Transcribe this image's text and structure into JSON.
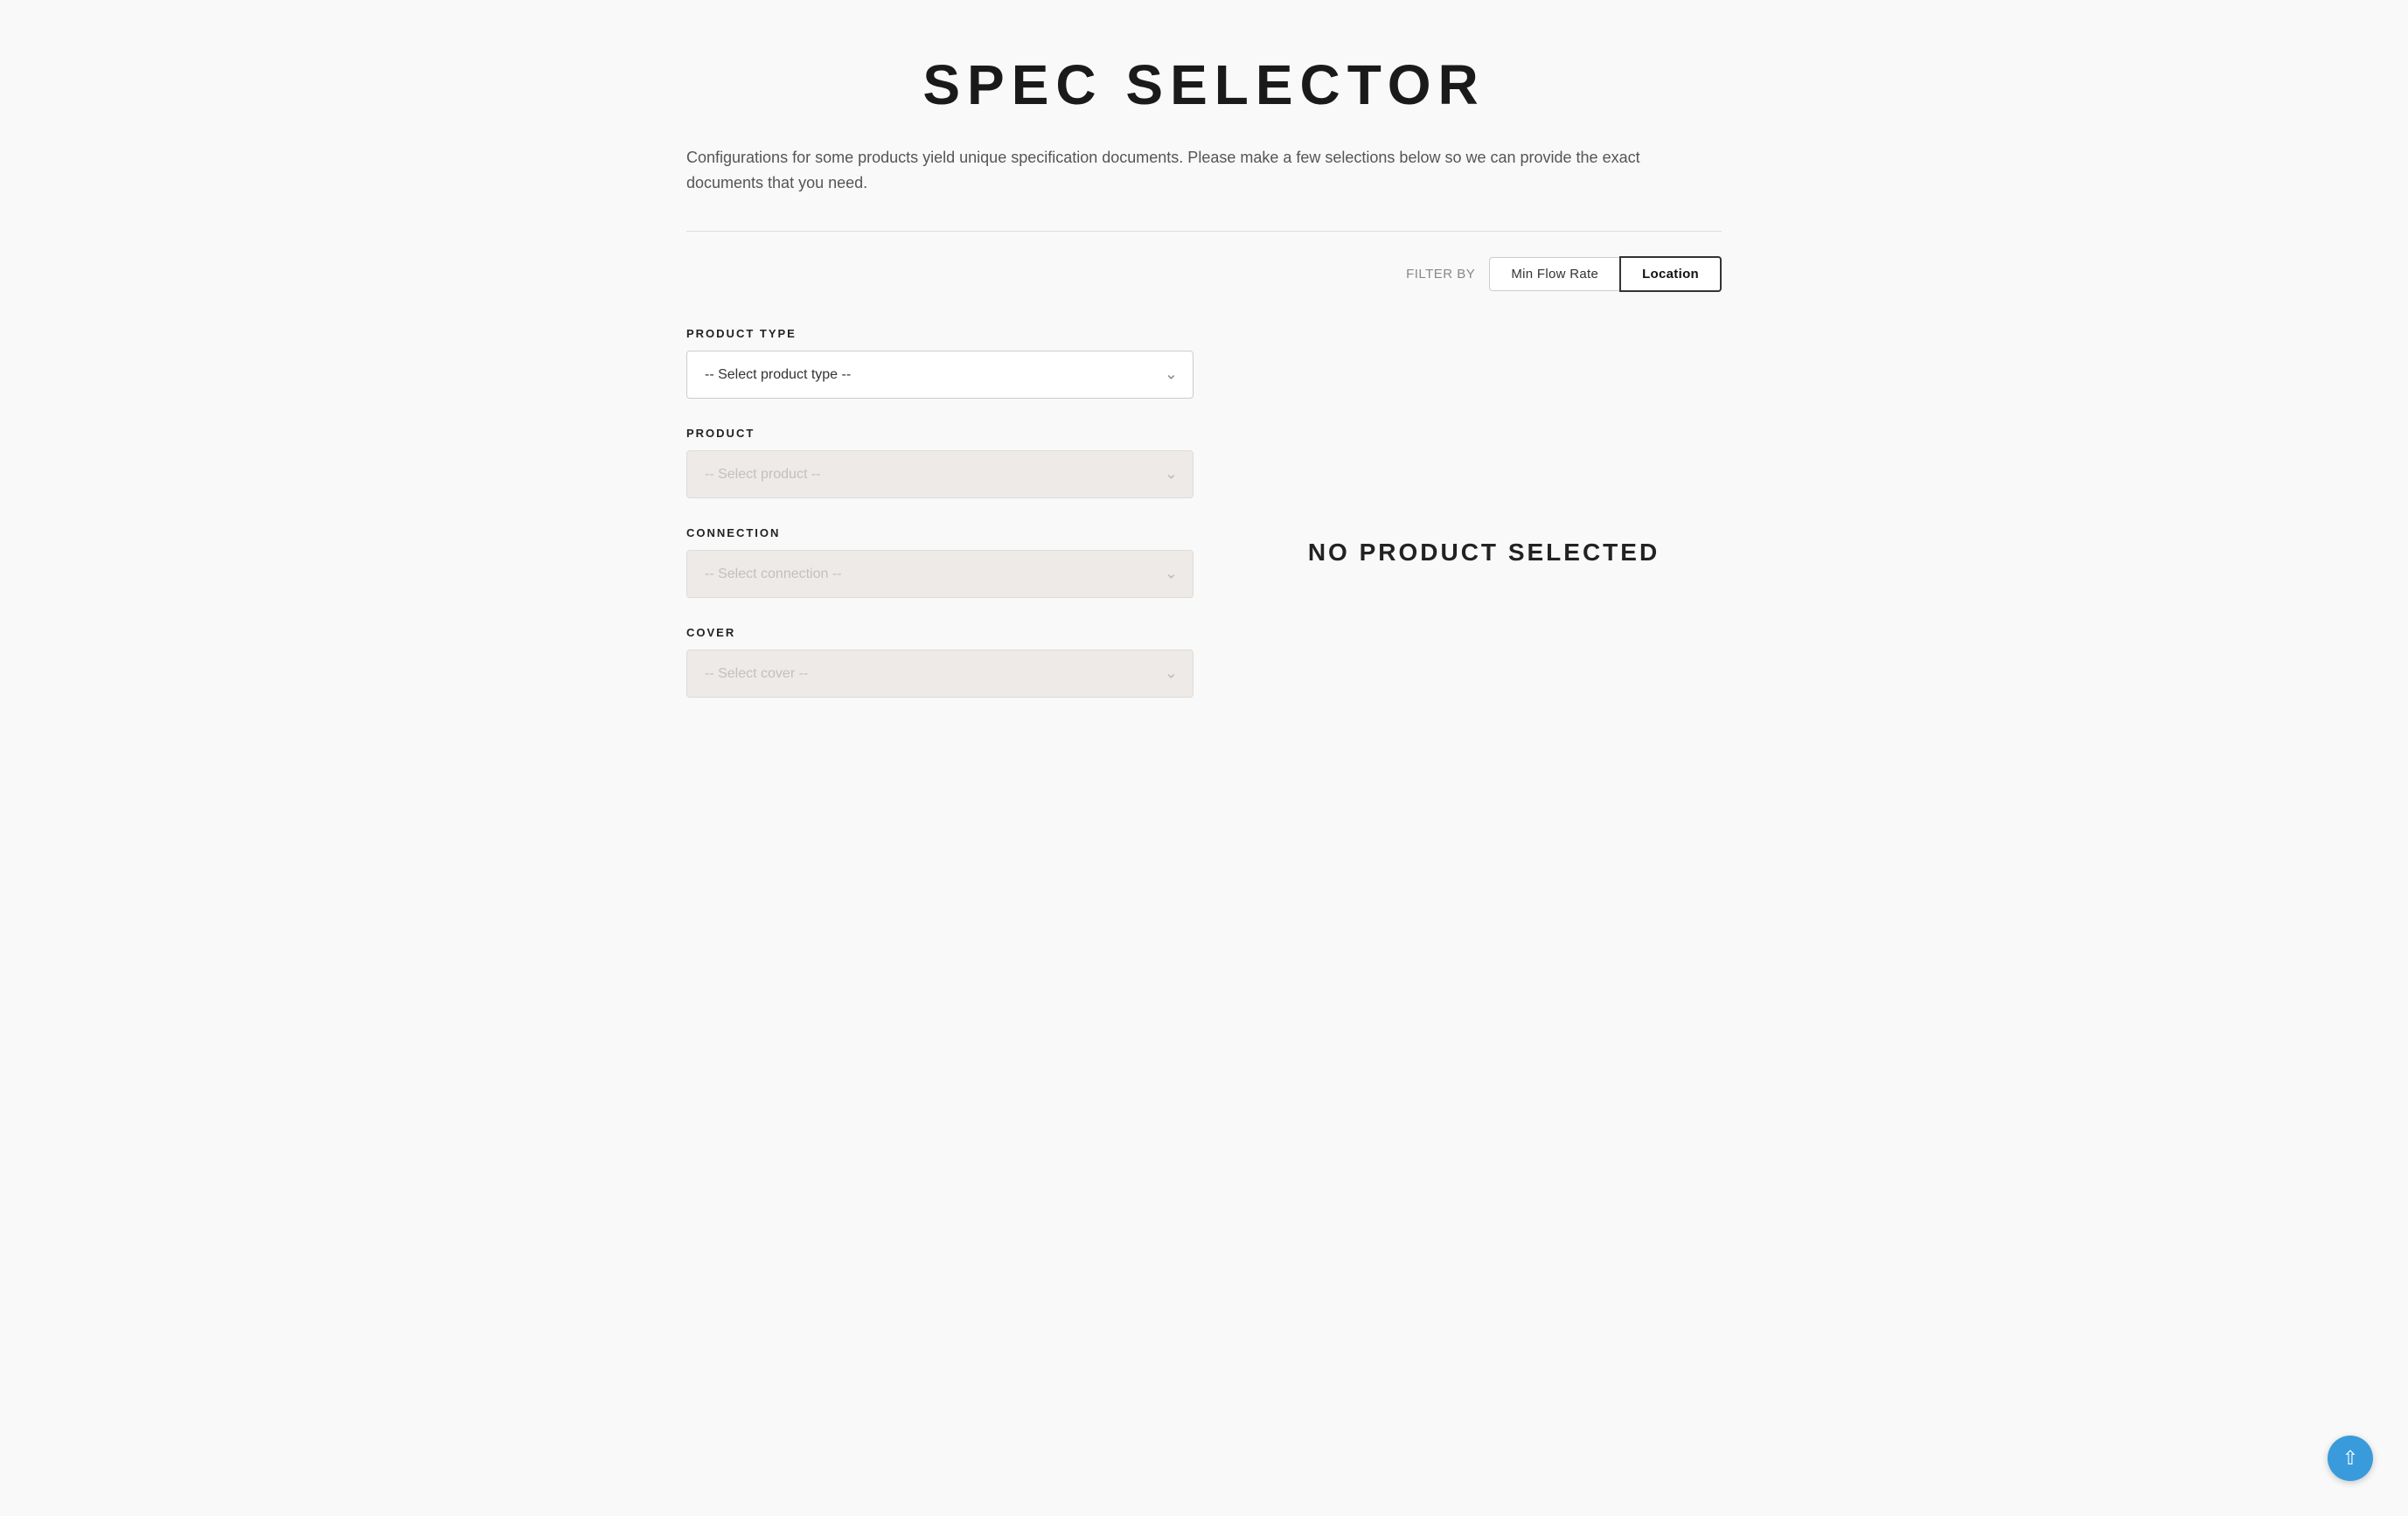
{
  "page": {
    "title": "SPEC SELECTOR",
    "description": "Configurations for some products yield unique specification documents. Please make a few selections below so we can provide the exact documents that you need."
  },
  "filter": {
    "label": "FILTER BY",
    "options": [
      {
        "id": "min-flow-rate",
        "label": "Min Flow Rate",
        "active": false
      },
      {
        "id": "location",
        "label": "Location",
        "active": true
      }
    ]
  },
  "form": {
    "fields": [
      {
        "id": "product-type",
        "label": "PRODUCT TYPE",
        "placeholder": "-- Select product type --",
        "disabled": false
      },
      {
        "id": "product",
        "label": "PRODUCT",
        "placeholder": "-- Select product --",
        "disabled": true
      },
      {
        "id": "connection",
        "label": "CONNECTION",
        "placeholder": "-- Select connection --",
        "disabled": true
      },
      {
        "id": "cover",
        "label": "COVER",
        "placeholder": "-- Select cover --",
        "disabled": true
      }
    ]
  },
  "right_panel": {
    "no_product_text": "NO PRODUCT SELECTED"
  },
  "scroll_to_top": {
    "label": "↑"
  }
}
